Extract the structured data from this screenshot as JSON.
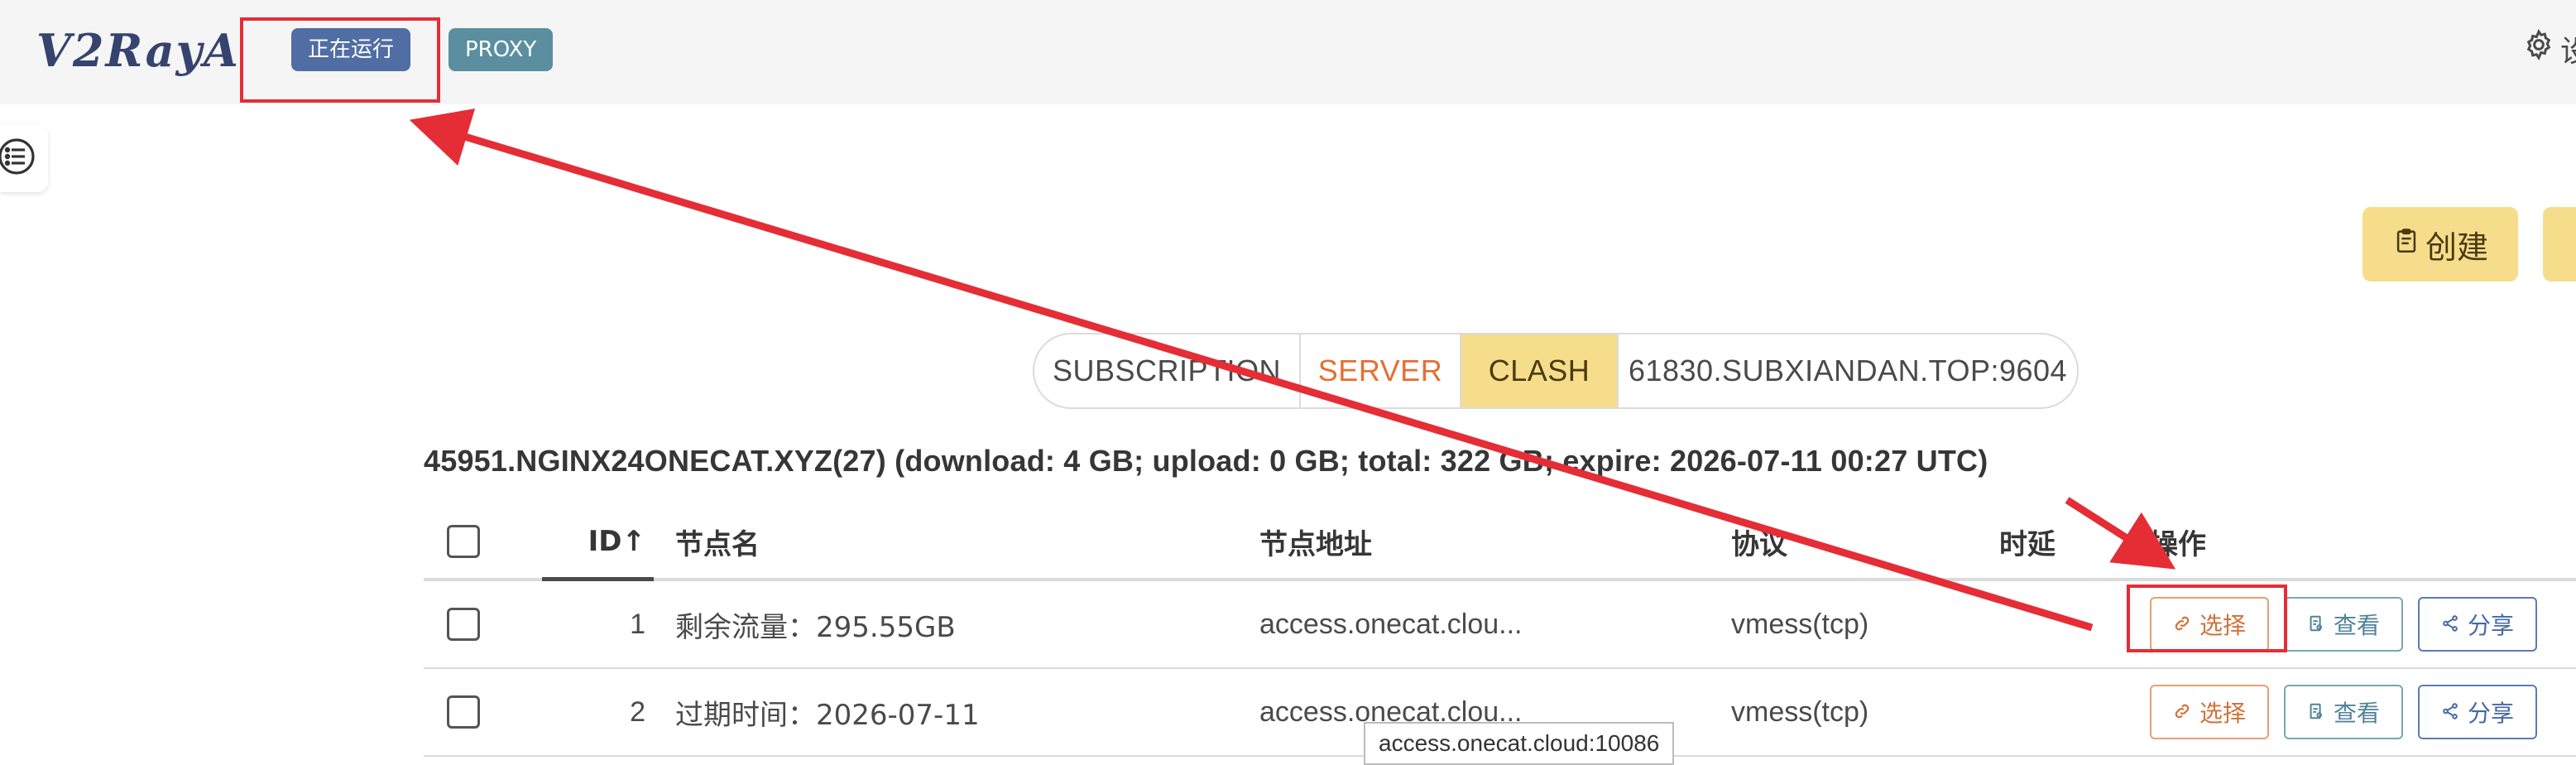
{
  "navbar": {
    "logo_text": "V2RayA",
    "status_tag": "正在运行",
    "proxy_tag": "PROXY",
    "settings_label": "设",
    "settings_icon": "gear-icon"
  },
  "sidebar": {
    "toggle_icon": "list-icon"
  },
  "toolbar": {
    "create_label": "创建",
    "create_icon": "clipboard-icon"
  },
  "tabs": [
    {
      "label": "SUBSCRIPTION"
    },
    {
      "label": "SERVER"
    },
    {
      "label": "CLASH"
    },
    {
      "label": "61830.SUBXIANDAN.TOP:9604"
    }
  ],
  "subscription_info": "45951.NGINX24ONECAT.XYZ(27) (download: 4 GB; upload: 0 GB; total: 322 GB; expire: 2026-07-11 00:27 UTC)",
  "table": {
    "headers": {
      "id": "ID↑",
      "name": "节点名",
      "address": "节点地址",
      "protocol": "协议",
      "latency": "时延",
      "actions": "操作"
    },
    "rows": [
      {
        "id": "1",
        "name": "剩余流量：295.55GB",
        "address": "access.onecat.clou...",
        "protocol": "vmess(tcp)",
        "latency": ""
      },
      {
        "id": "2",
        "name": "过期时间：2026-07-11",
        "address": "access.onecat.clou...",
        "protocol": "vmess(tcp)",
        "latency": ""
      }
    ],
    "actions": {
      "select": "选择",
      "view": "查看",
      "share": "分享"
    }
  },
  "tooltip": "access.onecat.cloud:10086",
  "colors": {
    "running_tag": "#506da4",
    "proxy_tag": "#5b8f9f",
    "accent_yellow": "#f6dd8c",
    "server_tab": "#e46f32",
    "annotation_red": "#e52d36"
  }
}
